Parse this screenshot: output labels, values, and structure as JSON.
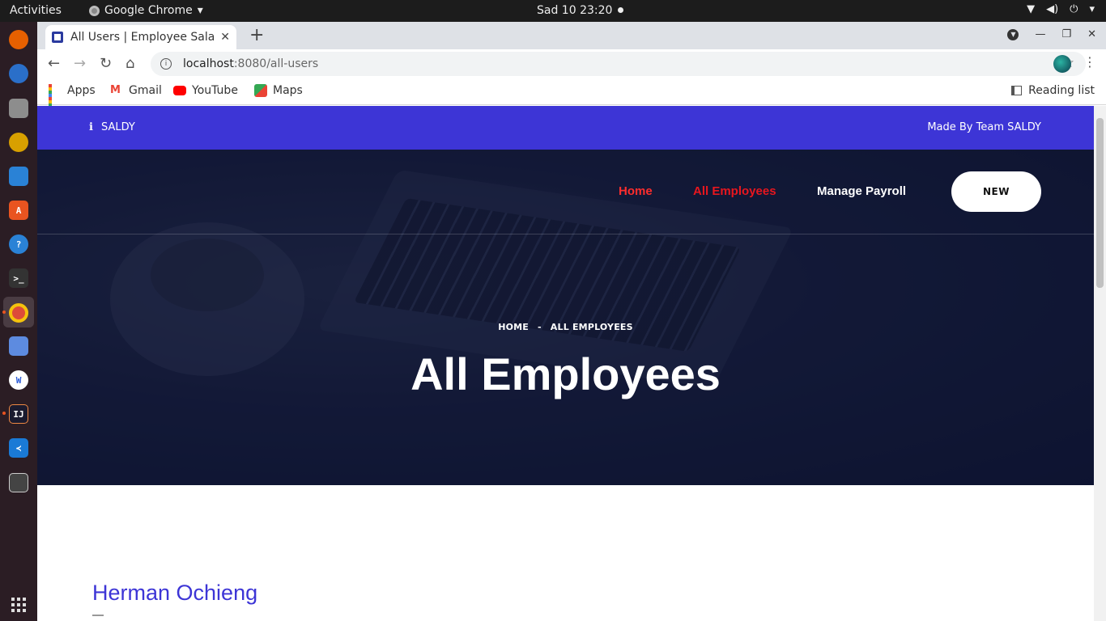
{
  "system": {
    "activities": "Activities",
    "app_name": "Google Chrome",
    "clock": "Sad 10  23:20"
  },
  "browser": {
    "tab_title": "All Users | Employee Salar",
    "url_host": "localhost",
    "url_rest": ":8080/all-users",
    "bookmarks": [
      "Apps",
      "Gmail",
      "YouTube",
      "Maps"
    ],
    "reading_list": "Reading list"
  },
  "site": {
    "topbar": {
      "brand": "SALDY",
      "made_by": "Made By Team SALDY"
    },
    "nav": {
      "home": "Home",
      "all_employees": "All Employees",
      "manage_payroll": "Manage Payroll",
      "new_button": "NEW"
    },
    "breadcrumb": {
      "home": "HOME",
      "separator": "-",
      "current": "ALL EMPLOYEES"
    },
    "hero_title": "All Employees",
    "employees": [
      {
        "name": "Herman Ochieng"
      }
    ]
  },
  "colors": {
    "accent": "#3d35d6",
    "nav_active": "#e8161e",
    "hero_bg": "#0f1633"
  }
}
